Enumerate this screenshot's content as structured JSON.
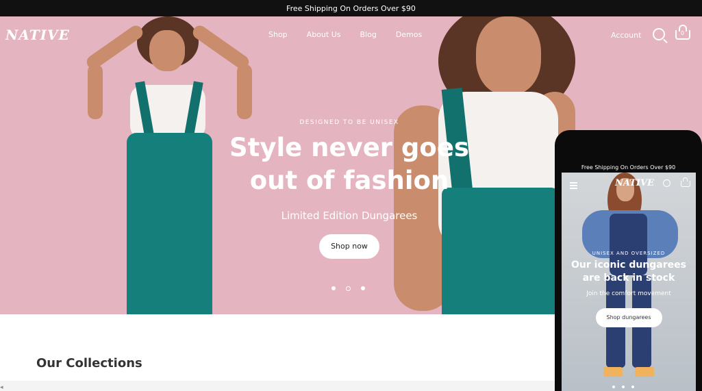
{
  "announcement": {
    "text": "Free Shipping On Orders Over $90"
  },
  "header": {
    "logo": "NATIVE",
    "menu": [
      "Shop",
      "About Us",
      "Blog",
      "Demos"
    ],
    "account": "Account",
    "cart_count": "0"
  },
  "hero": {
    "eyebrow": "DESIGNED TO BE UNISEX",
    "headline_line1": "Style never goes",
    "headline_line2": "out of fashion",
    "subtitle": "Limited Edition Dungarees",
    "button": "Shop now",
    "slide_count": 3
  },
  "collections": {
    "title": "Our Collections"
  },
  "phone": {
    "announcement": "Free Shipping On Orders Over $90",
    "logo": "NATIVE",
    "eyebrow": "UNISEX AND OVERSIZED",
    "headline_line1": "Our iconic dungarees",
    "headline_line2": "are back in stock",
    "subtitle": "Join the comfort movement",
    "button": "Shop dungarees",
    "slide_count": 3
  },
  "colors": {
    "hero_bg": "#e5b4c1",
    "topbar": "#111111",
    "dungaree_teal": "#157f7c"
  }
}
